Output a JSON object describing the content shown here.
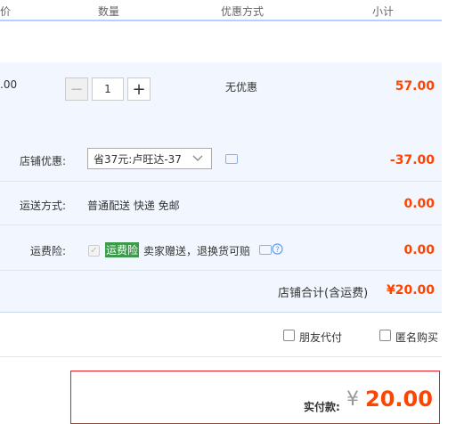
{
  "header": {
    "col_price_partial": "价",
    "col_qty": "数量",
    "col_discount": "优惠方式",
    "col_subtotal": "小计"
  },
  "item": {
    "price_partial": ".00",
    "quantity": "1",
    "minus": "−",
    "plus": "+",
    "discount": "无优惠",
    "subtotal": "57.00"
  },
  "shop_discount": {
    "label": "店铺优惠:",
    "selected": "省37元:卢旺达-37",
    "amount": "-37.00"
  },
  "shipping": {
    "label": "运送方式:",
    "value": "普通配送 快递 免邮",
    "amount": "0.00"
  },
  "insurance": {
    "label": "运费险:",
    "badge": "运费险",
    "text": "卖家赠送，退换货可赔",
    "amount": "0.00"
  },
  "shop_total": {
    "label": "店铺合计(含运费)",
    "amount": "¥20.00"
  },
  "options": {
    "friend_pay": "朋友代付",
    "anonymous": "匿名购买"
  },
  "payment": {
    "label": "实付款:",
    "currency": "¥",
    "amount": "20.00"
  },
  "colors": {
    "accent_red": "#ff4400",
    "row_bg": "#f2f7ff",
    "header_line": "#b2d1ff",
    "badge_green": "#3c9b4a"
  }
}
